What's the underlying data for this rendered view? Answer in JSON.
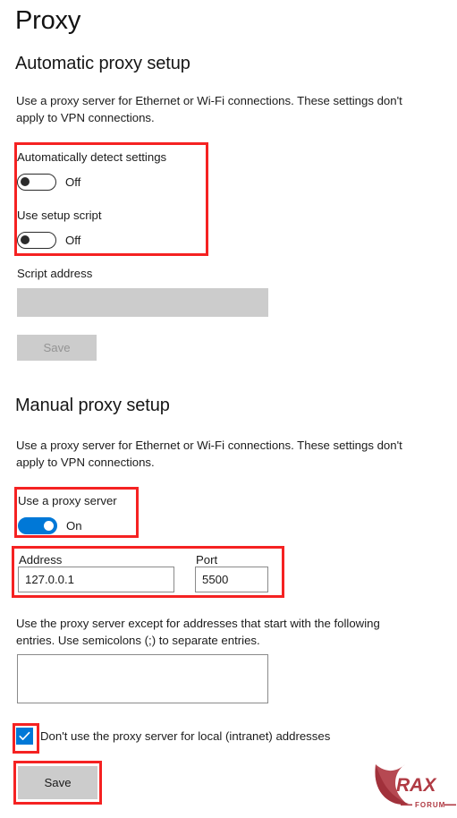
{
  "page": {
    "title": "Proxy"
  },
  "automatic": {
    "heading": "Automatic proxy setup",
    "description": "Use a proxy server for Ethernet or Wi-Fi connections. These settings don't apply to VPN connections.",
    "auto_detect": {
      "label": "Automatically detect settings",
      "state": "Off"
    },
    "setup_script": {
      "label": "Use setup script",
      "state": "Off"
    },
    "script_address": {
      "label": "Script address",
      "value": "",
      "placeholder": ""
    },
    "save_label": "Save"
  },
  "manual": {
    "heading": "Manual proxy setup",
    "description": "Use a proxy server for Ethernet or Wi-Fi connections. These settings don't apply to VPN connections.",
    "use_proxy": {
      "label": "Use a proxy server",
      "state": "On"
    },
    "address": {
      "label": "Address",
      "value": "127.0.0.1",
      "placeholder": ""
    },
    "port": {
      "label": "Port",
      "value": "5500",
      "placeholder": ""
    },
    "exceptions": {
      "description": "Use the proxy server except for addresses that start with the following entries. Use semicolons (;) to separate entries.",
      "value": "",
      "placeholder": ""
    },
    "bypass_local": {
      "label": "Don't use the proxy server for local (intranet) addresses",
      "checked": "true"
    },
    "save_label": "Save"
  },
  "watermark": {
    "brand": "RAX",
    "subtitle": "FORUM"
  },
  "colors": {
    "accent_blue": "#0078d7",
    "annotation_red": "#f52222",
    "disabled_gray": "#cccccc",
    "input_border": "#8a8a8a",
    "watermark_red": "#b03a43"
  }
}
